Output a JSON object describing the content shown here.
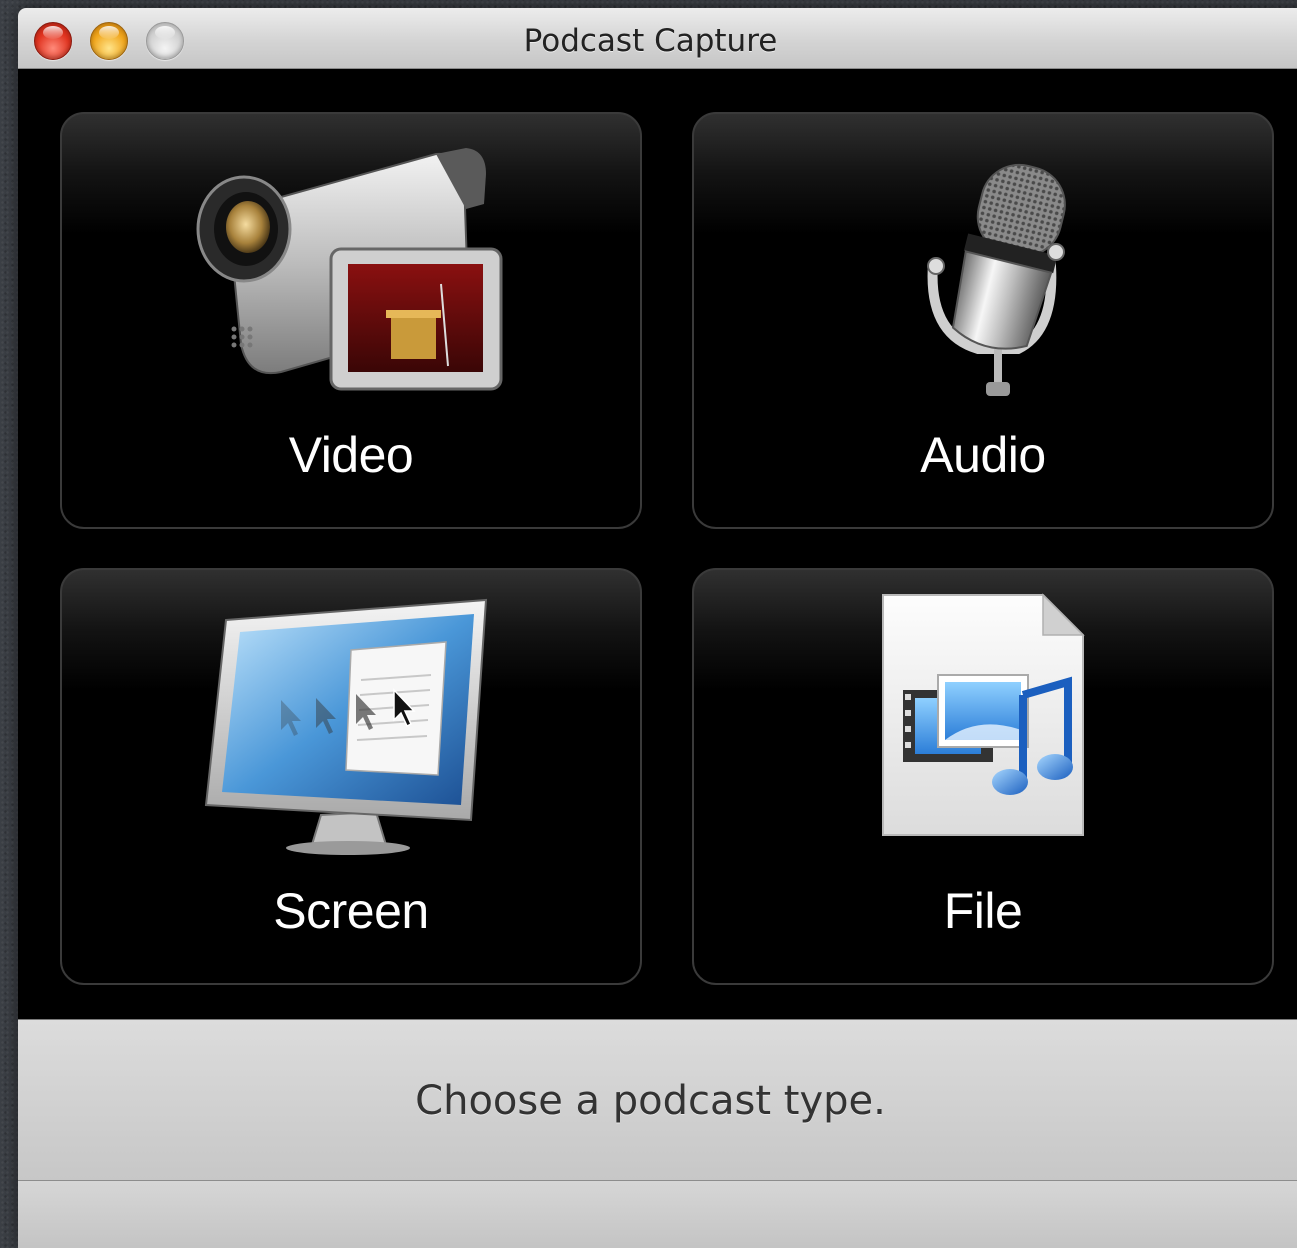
{
  "window": {
    "title": "Podcast Capture"
  },
  "tiles": [
    {
      "label": "Video",
      "icon": "video-camera-icon"
    },
    {
      "label": "Audio",
      "icon": "microphone-icon"
    },
    {
      "label": "Screen",
      "icon": "display-screen-icon"
    },
    {
      "label": "File",
      "icon": "media-file-icon"
    }
  ],
  "status": {
    "text": "Choose a podcast type."
  }
}
